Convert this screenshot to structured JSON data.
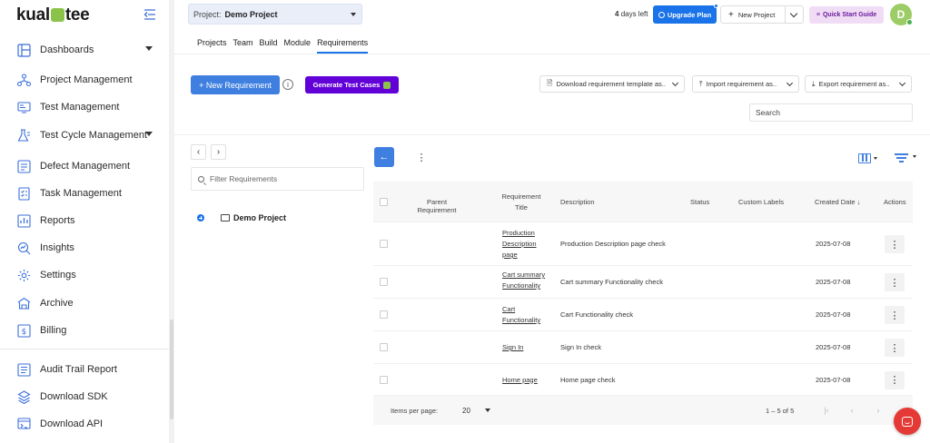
{
  "logo": {
    "text_left": "kual",
    "text_right": "tee"
  },
  "sidebar": {
    "items": [
      {
        "label": "Dashboards",
        "icon": "dashboard-icon",
        "has_caret": true
      },
      {
        "label": "Project Management",
        "icon": "project-management-icon"
      },
      {
        "label": "Test Management",
        "icon": "test-management-icon"
      },
      {
        "label": "Test Cycle Management",
        "icon": "test-cycle-icon",
        "has_caret": true
      },
      {
        "label": "Defect Management",
        "icon": "defect-icon"
      },
      {
        "label": "Task Management",
        "icon": "task-icon"
      },
      {
        "label": "Reports",
        "icon": "reports-icon"
      },
      {
        "label": "Insights",
        "icon": "insights-icon"
      },
      {
        "label": "Settings",
        "icon": "settings-icon"
      },
      {
        "label": "Archive",
        "icon": "archive-icon"
      },
      {
        "label": "Billing",
        "icon": "billing-icon"
      },
      {
        "label": "Audit Trail Report",
        "icon": "audit-icon"
      },
      {
        "label": "Download SDK",
        "icon": "download-sdk-icon"
      },
      {
        "label": "Download API",
        "icon": "download-api-icon"
      }
    ]
  },
  "topbar": {
    "project_label": "Project:",
    "project_value": "Demo Project",
    "days_left_number": "4",
    "days_left_text": "days left",
    "upgrade_label": "Upgrade Plan",
    "new_project_label": "New Project",
    "quick_start_label": "Quick Start Guide",
    "avatar_initial": "D"
  },
  "tabs": [
    "Projects",
    "Team",
    "Build",
    "Module",
    "Requirements"
  ],
  "active_tab": "Requirements",
  "actions": {
    "new_requirement_label": "+ New Requirement",
    "generate_label": "Generate Test Cases",
    "download_template_label": "Download requirement template as..",
    "import_label": "Import requirement as..",
    "export_label": "Export requirement as..",
    "search_placeholder": "Search"
  },
  "tree": {
    "filter_placeholder": "Filter Requirements",
    "root_label": "Demo Project"
  },
  "grid": {
    "headers": {
      "parent": "Parent Requirement",
      "title": "Requirement Title",
      "description": "Description",
      "status": "Status",
      "labels": "Custom Labels",
      "created": "Created Date",
      "actions": "Actions"
    },
    "rows": [
      {
        "title": "Production Description page",
        "description": "Production Description page check",
        "status": "",
        "labels": "",
        "created": "2025-07-08"
      },
      {
        "title": "Cart summary Functionality",
        "description": "Cart summary Functionality check",
        "status": "",
        "labels": "",
        "created": "2025-07-08"
      },
      {
        "title": "Cart Functionality",
        "description": "Cart Functionality check",
        "status": "",
        "labels": "",
        "created": "2025-07-08"
      },
      {
        "title": "Sign In",
        "description": "Sign In check",
        "status": "",
        "labels": "",
        "created": "2025-07-08"
      },
      {
        "title": "Home page",
        "description": "Home page check",
        "status": "",
        "labels": "",
        "created": "2025-07-08"
      }
    ],
    "footer": {
      "items_per_page_label": "Items per page:",
      "items_per_page_value": "20",
      "range_text": "1 – 5 of 5"
    }
  },
  "colors": {
    "primary": "#1a73e8",
    "generate_purple": "#6200d8",
    "quick_start_bg": "#f1dcf5",
    "brand_green": "#8bc34a",
    "chat_red": "#e53935"
  }
}
